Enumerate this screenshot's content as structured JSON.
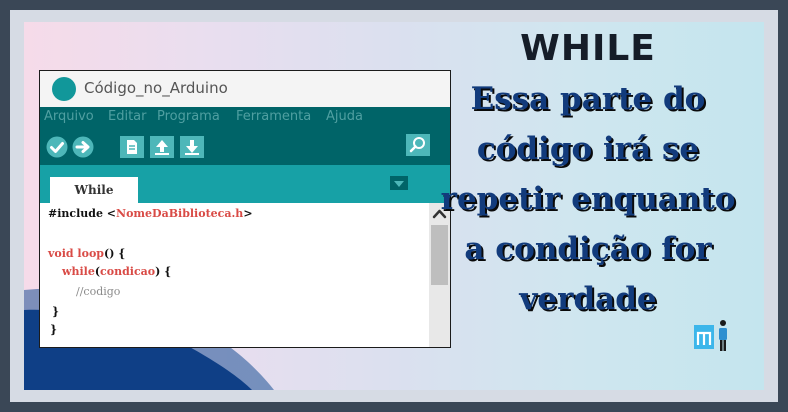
{
  "window": {
    "title": "Código_no_Arduino"
  },
  "menu": {
    "items": [
      "Arquivo",
      "Editar",
      "Programa",
      "Ferramenta",
      "Ajuda"
    ]
  },
  "toolbar": {
    "icons": [
      "verify-icon",
      "upload-icon",
      "new-file-icon",
      "open-icon",
      "save-icon",
      "serial-monitor-icon"
    ]
  },
  "tab": {
    "label": "While"
  },
  "code": {
    "include_prefix": "#include <",
    "include_library": "NomeDaBiblioteca.h",
    "include_suffix": ">",
    "loop_keyword": "void loop",
    "loop_rest": "() {",
    "while_keyword": "while",
    "while_open": "(",
    "while_condition": "condicao",
    "while_close": ") {",
    "comment": "//codigo",
    "close_inner": "}",
    "close_outer": "}"
  },
  "slide": {
    "heading": "WHILE",
    "description_lines": [
      "Essa parte do",
      "código irá se",
      "repetir enquanto",
      "a condição for",
      "verdade"
    ]
  },
  "colors": {
    "arduino_dark_teal": "#006468",
    "arduino_teal": "#17a1a6",
    "keyword_red": "#d94b46",
    "heading_dark": "#151d28",
    "description_blue": "#123b7c",
    "frame_slate": "#3a4756"
  },
  "brand": {
    "icon": "mi-logo-icon"
  }
}
